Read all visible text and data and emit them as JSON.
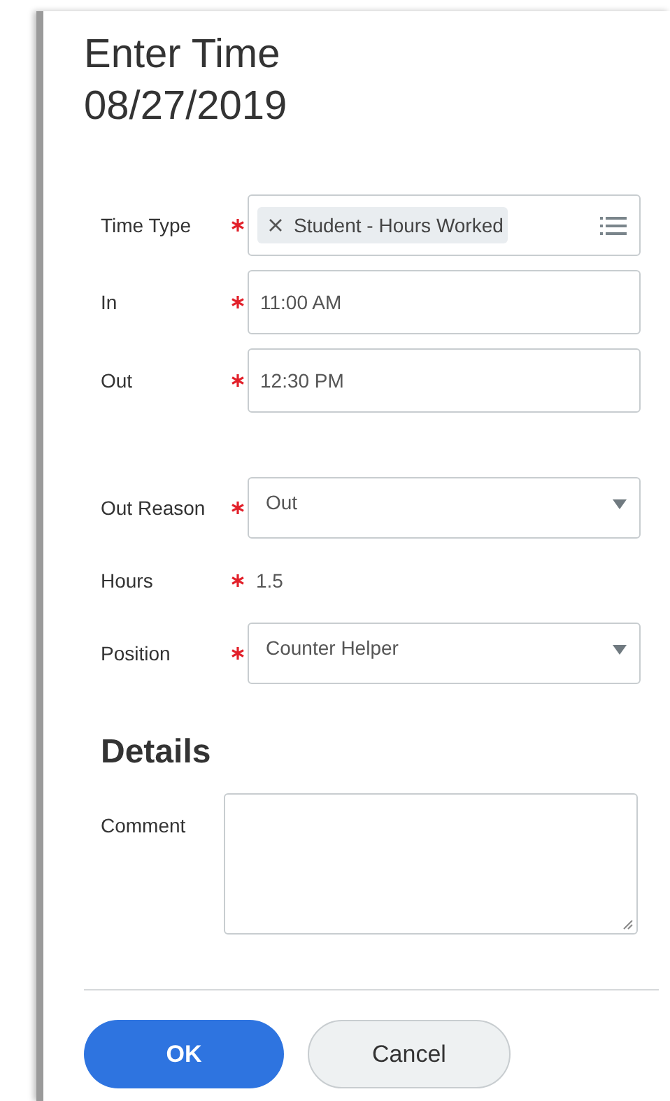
{
  "title": "Enter Time",
  "date": "08/27/2019",
  "field_groups": [
    [
      {
        "kind": "multiselect",
        "label": "Time Type",
        "required": true,
        "value": "Student - Hours Worked"
      },
      {
        "kind": "text",
        "label": "In",
        "required": true,
        "value": "11:00 AM"
      },
      {
        "kind": "text",
        "label": "Out",
        "required": true,
        "value": "12:30 PM"
      }
    ],
    [
      {
        "kind": "select",
        "label": "Out Reason",
        "required": true,
        "value": "Out"
      },
      {
        "kind": "readonly",
        "label": "Hours",
        "required": true,
        "value": "1.5"
      },
      {
        "kind": "select",
        "label": "Position",
        "required": true,
        "value": "Counter Helper"
      }
    ]
  ],
  "details": {
    "heading": "Details",
    "fields": [
      {
        "kind": "textarea",
        "label": "Comment",
        "required": false
      }
    ]
  },
  "buttons": [
    {
      "label": "OK",
      "kind": "primary"
    },
    {
      "label": "Cancel",
      "kind": "secondary"
    }
  ]
}
